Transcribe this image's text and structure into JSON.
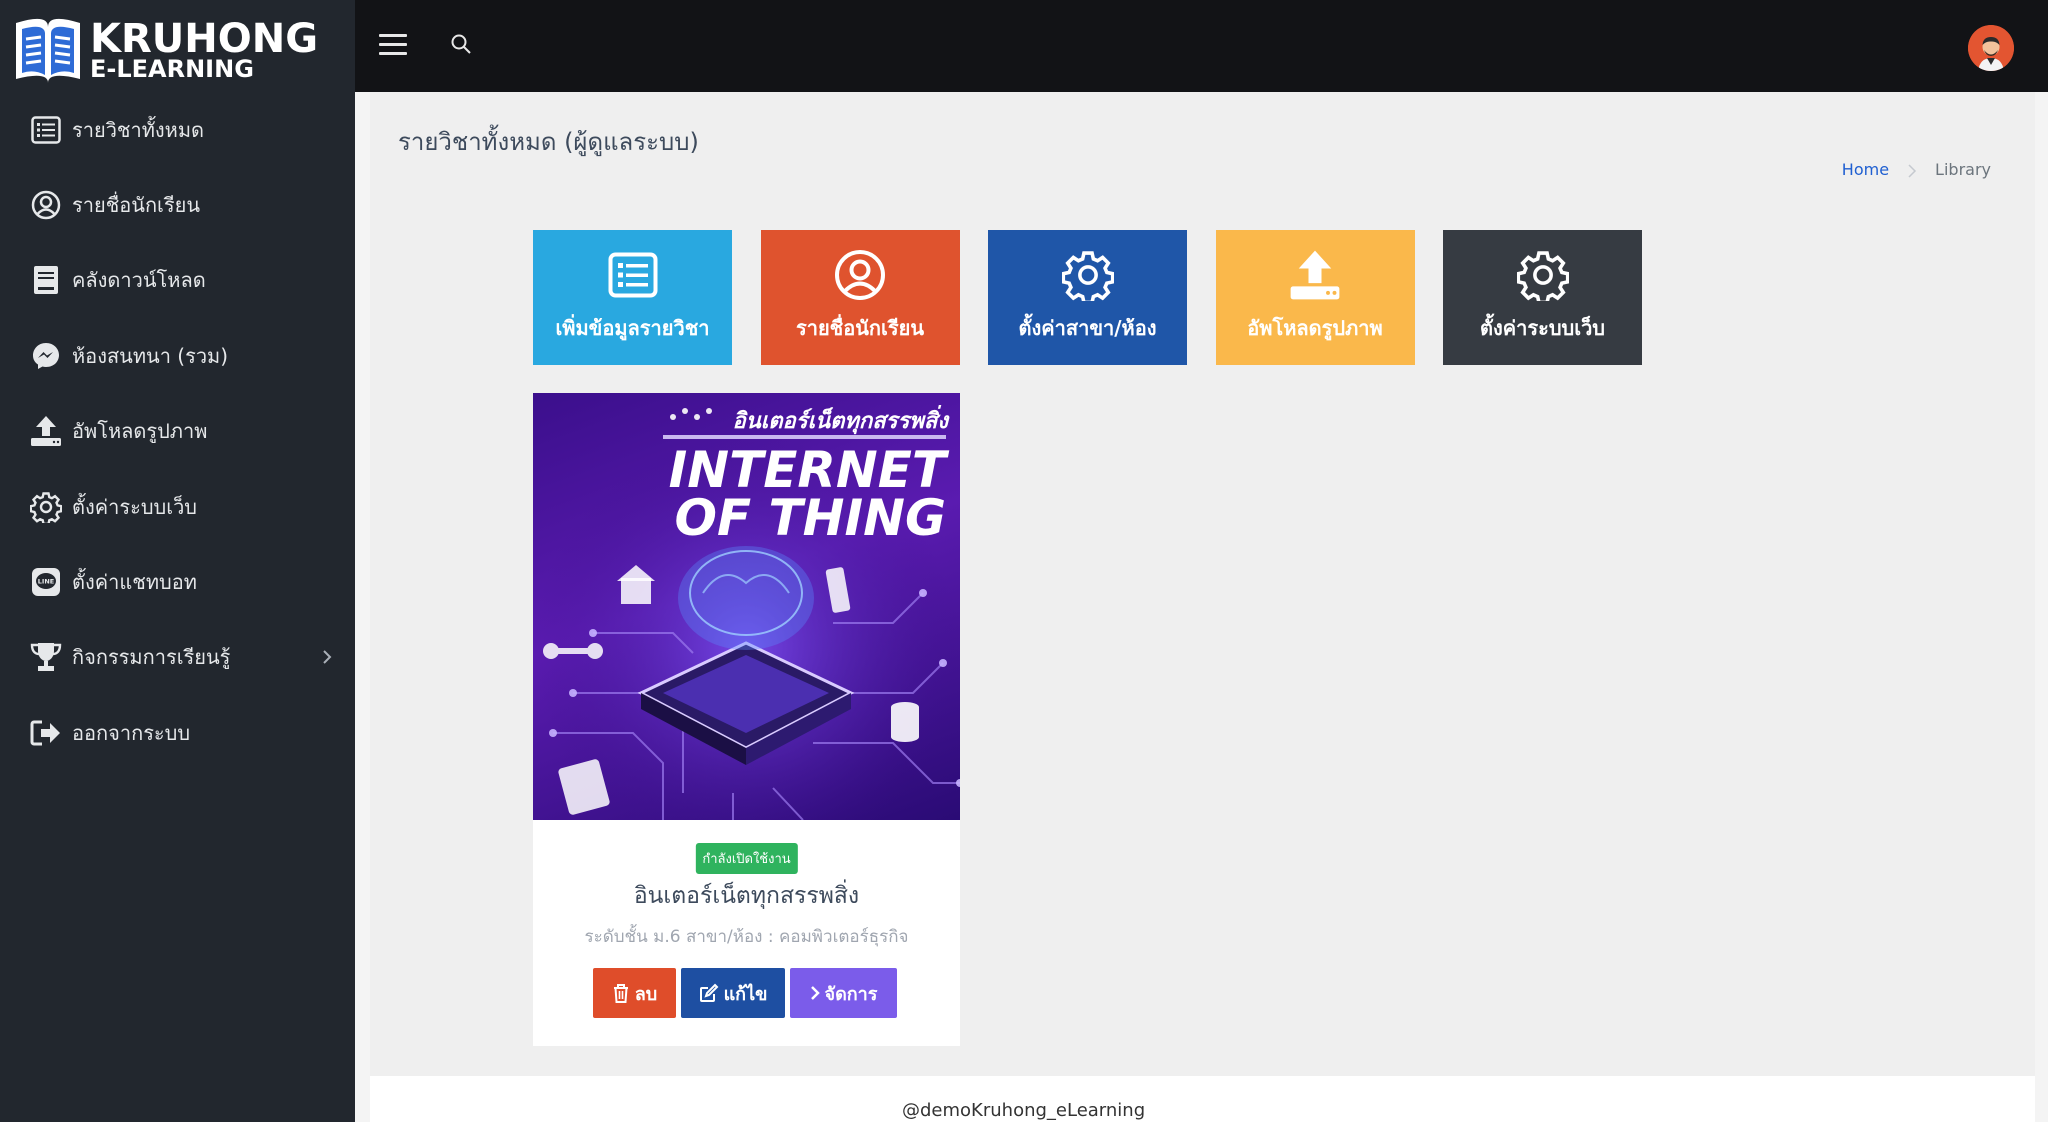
{
  "brand": {
    "line1": "KRUHONG",
    "line2": "E-LEARNING"
  },
  "sidebar": {
    "items": [
      {
        "label": "รายวิชาทั้งหมด",
        "icon": "list-icon"
      },
      {
        "label": "รายชื่อนักเรียน",
        "icon": "user-circle-icon"
      },
      {
        "label": "คลังดาวน์โหลด",
        "icon": "book-icon"
      },
      {
        "label": "ห้องสนทนา (รวม)",
        "icon": "messenger-icon"
      },
      {
        "label": "อัพโหลดรูปภาพ",
        "icon": "upload-icon"
      },
      {
        "label": "ตั้งค่าระบบเว็บ",
        "icon": "gear-icon"
      },
      {
        "label": "ตั้งค่าแชทบอท",
        "icon": "line-icon"
      },
      {
        "label": "กิจกรรมการเรียนรู้",
        "icon": "trophy-icon"
      },
      {
        "label": "ออกจากระบบ",
        "icon": "logout-icon"
      }
    ]
  },
  "page": {
    "title": "รายวิชาทั้งหมด (ผู้ดูแลระบบ)",
    "breadcrumb": {
      "home": "Home",
      "current": "Library"
    }
  },
  "tiles": [
    {
      "label": "เพิ่มข้อมูลรายวิชา",
      "color": "#29a8e0",
      "icon": "list-icon"
    },
    {
      "label": "รายชื่อนักเรียน",
      "color": "#df532e",
      "icon": "user-circle-icon"
    },
    {
      "label": "ตั้งค่าสาขา/ห้อง",
      "color": "#1f56a8",
      "icon": "gear-icon"
    },
    {
      "label": "อัพโหลดรูปภาพ",
      "color": "#fab84b",
      "icon": "upload-icon"
    },
    {
      "label": "ตั้งค่าระบบเว็บ",
      "color": "#363b42",
      "icon": "gear-icon"
    }
  ],
  "course": {
    "image_caption": "อินเตอร์เน็ตทุกสรรพสิ่ง",
    "image_title_1": "INTERNET",
    "image_title_2": "OF THING",
    "status": "กำลังเปิดใช้งาน",
    "title": "อินเตอร์เน็ตทุกสรรพสิ่ง",
    "subtitle": "ระดับชั้น ม.6 สาขา/ห้อง : คอมพิวเตอร์ธุรกิจ",
    "buttons": {
      "delete": "ลบ",
      "edit": "แก้ไข",
      "manage": "จัดการ"
    }
  },
  "footer": {
    "text": "@demoKruhong_eLearning"
  }
}
